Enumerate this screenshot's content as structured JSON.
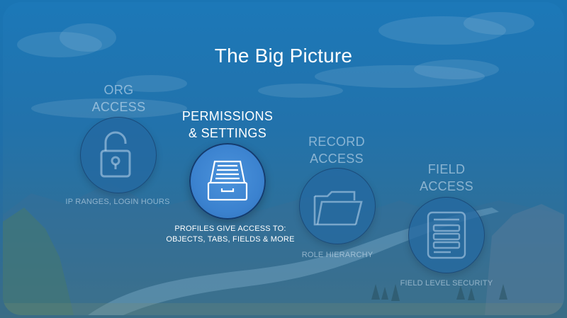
{
  "slide": {
    "title": "The Big Picture"
  },
  "cards": [
    {
      "id": "org",
      "heading_line1": "ORG",
      "heading_line2": "ACCESS",
      "icon": "padlock-icon",
      "caption_line1": "IP RANGES, LOGIN HOURS",
      "caption_line2": ""
    },
    {
      "id": "perms",
      "heading_line1": "PERMISSIONS",
      "heading_line2": "& SETTINGS",
      "icon": "file-drawer-icon",
      "caption_line1": "PROFILES GIVE ACCESS TO:",
      "caption_line2": "OBJECTS, TABS, FIELDS & MORE"
    },
    {
      "id": "record",
      "heading_line1": "RECORD",
      "heading_line2": "ACCESS",
      "icon": "folder-icon",
      "caption_line1": "ROLE HIERARCHY",
      "caption_line2": ""
    },
    {
      "id": "field",
      "heading_line1": "FIELD",
      "heading_line2": "ACCESS",
      "icon": "form-fields-icon",
      "caption_line1": "FIELD LEVEL SECURITY",
      "caption_line2": ""
    }
  ],
  "colors": {
    "background": "#1c78b8",
    "highlight_circle": "#3d86d4",
    "dim_circle": "#2a6ea6"
  }
}
